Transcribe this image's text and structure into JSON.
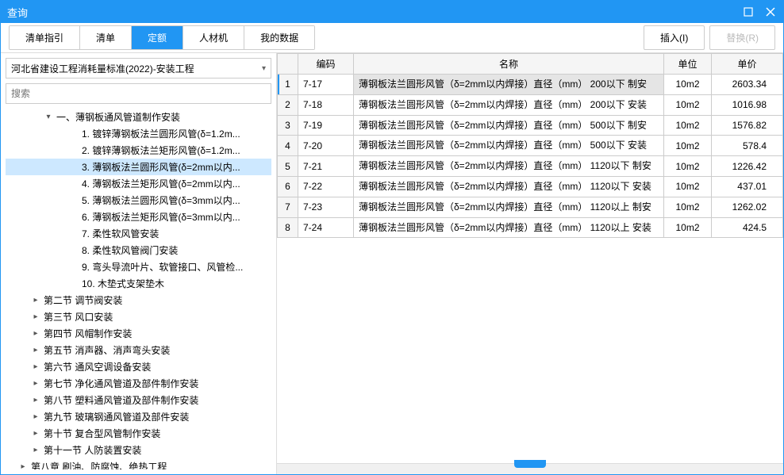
{
  "window": {
    "title": "查询"
  },
  "toolbar": {
    "tabs": [
      "清单指引",
      "清单",
      "定额",
      "人材机",
      "我的数据"
    ],
    "active_tab": 2,
    "insert_btn": "插入(I)",
    "replace_btn": "替换(R)"
  },
  "dropdown": {
    "selected": "河北省建设工程消耗量标准(2022)-安装工程"
  },
  "search": {
    "placeholder": "搜索"
  },
  "tree": [
    {
      "indent": 3,
      "toggle": "down",
      "label": "一、薄钢板通风管道制作安装"
    },
    {
      "indent": 5,
      "toggle": "",
      "label": "1. 镀锌薄钢板法兰圆形风管(δ=1.2m..."
    },
    {
      "indent": 5,
      "toggle": "",
      "label": "2. 镀锌薄钢板法兰矩形风管(δ=1.2m..."
    },
    {
      "indent": 5,
      "toggle": "",
      "label": "3. 薄钢板法兰圆形风管(δ=2mm以内...",
      "selected": true
    },
    {
      "indent": 5,
      "toggle": "",
      "label": "4. 薄钢板法兰矩形风管(δ=2mm以内..."
    },
    {
      "indent": 5,
      "toggle": "",
      "label": "5. 薄钢板法兰圆形风管(δ=3mm以内..."
    },
    {
      "indent": 5,
      "toggle": "",
      "label": "6. 薄钢板法兰矩形风管(δ=3mm以内..."
    },
    {
      "indent": 5,
      "toggle": "",
      "label": "7. 柔性软风管安装"
    },
    {
      "indent": 5,
      "toggle": "",
      "label": "8. 柔性软风管阀门安装"
    },
    {
      "indent": 5,
      "toggle": "",
      "label": "9. 弯头导流叶片、软管接口、风管检..."
    },
    {
      "indent": 5,
      "toggle": "",
      "label": "10. 木垫式支架垫木"
    },
    {
      "indent": 2,
      "toggle": "right",
      "label": "第二节 调节阀安装"
    },
    {
      "indent": 2,
      "toggle": "right",
      "label": "第三节 风口安装"
    },
    {
      "indent": 2,
      "toggle": "right",
      "label": "第四节 风帽制作安装"
    },
    {
      "indent": 2,
      "toggle": "right",
      "label": "第五节 消声器、消声弯头安装"
    },
    {
      "indent": 2,
      "toggle": "right",
      "label": "第六节 通风空调设备安装"
    },
    {
      "indent": 2,
      "toggle": "right",
      "label": "第七节 净化通风管道及部件制作安装"
    },
    {
      "indent": 2,
      "toggle": "right",
      "label": "第八节 塑料通风管道及部件制作安装"
    },
    {
      "indent": 2,
      "toggle": "right",
      "label": "第九节 玻璃钢通风管道及部件安装"
    },
    {
      "indent": 2,
      "toggle": "right",
      "label": "第十节 复合型风管制作安装"
    },
    {
      "indent": 2,
      "toggle": "right",
      "label": "第十一节 人防装置安装"
    },
    {
      "indent": 1,
      "toggle": "right",
      "label": "第八章 刷油、防腐蚀、绝热工程"
    }
  ],
  "grid": {
    "headers": {
      "code": "编码",
      "name": "名称",
      "unit": "单位",
      "price": "单价"
    },
    "rows": [
      {
        "n": "1",
        "code": "7-17",
        "name": "薄钢板法兰圆形风管（δ=2mm以内焊接）直径（mm） 200以下 制安",
        "unit": "10m2",
        "price": "2603.34",
        "selected": true
      },
      {
        "n": "2",
        "code": "7-18",
        "name": "薄钢板法兰圆形风管（δ=2mm以内焊接）直径（mm） 200以下 安装",
        "unit": "10m2",
        "price": "1016.98"
      },
      {
        "n": "3",
        "code": "7-19",
        "name": "薄钢板法兰圆形风管（δ=2mm以内焊接）直径（mm） 500以下 制安",
        "unit": "10m2",
        "price": "1576.82"
      },
      {
        "n": "4",
        "code": "7-20",
        "name": "薄钢板法兰圆形风管（δ=2mm以内焊接）直径（mm） 500以下 安装",
        "unit": "10m2",
        "price": "578.4"
      },
      {
        "n": "5",
        "code": "7-21",
        "name": "薄钢板法兰圆形风管（δ=2mm以内焊接）直径（mm） 1120以下 制安",
        "unit": "10m2",
        "price": "1226.42"
      },
      {
        "n": "6",
        "code": "7-22",
        "name": "薄钢板法兰圆形风管（δ=2mm以内焊接）直径（mm） 1120以下 安装",
        "unit": "10m2",
        "price": "437.01"
      },
      {
        "n": "7",
        "code": "7-23",
        "name": "薄钢板法兰圆形风管（δ=2mm以内焊接）直径（mm） 1120以上 制安",
        "unit": "10m2",
        "price": "1262.02"
      },
      {
        "n": "8",
        "code": "7-24",
        "name": "薄钢板法兰圆形风管（δ=2mm以内焊接）直径（mm） 1120以上 安装",
        "unit": "10m2",
        "price": "424.5"
      }
    ]
  }
}
